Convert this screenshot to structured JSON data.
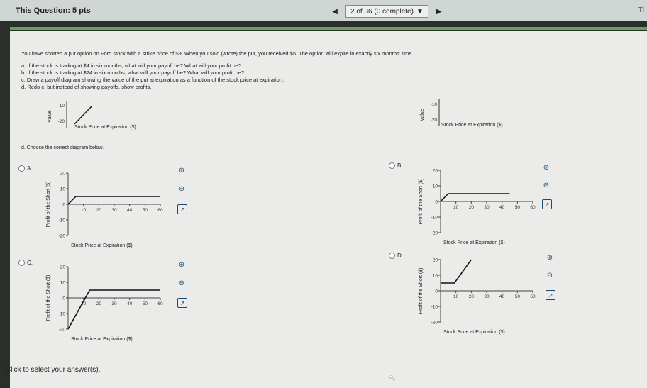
{
  "header": {
    "question_label": "This Question: 5 pts",
    "counter": "2 of 36 (0 complete)",
    "right_text": "Tl"
  },
  "question": {
    "prompt": "You have shorted a put option on Ford stock with a strike price of $9. When you sold (wrote) the put, you received $5. The option will expire in exactly six months' time.",
    "items": [
      "a. If the stock is trading at $4 in six months, what will your payoff be? What will your profit be?",
      "b. If the stock is trading at $24 in six months, what will your payoff be? What will your profit be?",
      "c. Draw a payoff diagram showing the value of the put at expiration as a function of the stock price at expiration.",
      "d. Redo c, but instead of showing payoffs, show profits."
    ],
    "sub_prompt": "d. Choose the correct diagram below."
  },
  "top_charts": {
    "left": {
      "ylabel": "Value",
      "xlabel": "Stock Price at Expiration ($)",
      "ticks": [
        "-10",
        "-20"
      ]
    },
    "right": {
      "ylabel": "Value",
      "xlabel": "Stock Price at Expiration ($)",
      "ticks": [
        "-10",
        "-20"
      ]
    }
  },
  "options": [
    {
      "letter": "A.",
      "ylabel": "Profit of the Short ($)",
      "xlabel": "Stock Price at Expiration ($)"
    },
    {
      "letter": "B.",
      "ylabel": "Profit of the Short ($)",
      "xlabel": "Stock Price at Expiration ($)"
    },
    {
      "letter": "C.",
      "ylabel": "Profit of the Short ($)",
      "xlabel": "Stock Price at Expiration ($)"
    },
    {
      "letter": "D.",
      "ylabel": "Profit of the Short ($)",
      "xlabel": "Stock Price at Expiration ($)"
    }
  ],
  "chart_data": [
    {
      "type": "line",
      "x": [
        0,
        5,
        60
      ],
      "y": [
        0,
        5,
        5
      ],
      "ylim": [
        -20,
        20
      ],
      "xlim": [
        0,
        60
      ],
      "xticks": [
        10,
        20,
        30,
        40,
        50,
        60
      ],
      "yticks": [
        20,
        10,
        0,
        -10,
        -20
      ]
    },
    {
      "type": "line",
      "x": [
        0,
        5,
        45
      ],
      "y": [
        0,
        5,
        5
      ],
      "ylim": [
        -20,
        20
      ],
      "xlim": [
        0,
        60
      ],
      "xticks": [
        10,
        20,
        30,
        40,
        50,
        60
      ],
      "yticks": [
        20,
        10,
        0,
        -10,
        -20
      ]
    },
    {
      "type": "line",
      "x": [
        0,
        14,
        60
      ],
      "y": [
        -20,
        5,
        5
      ],
      "ylim": [
        -20,
        20
      ],
      "xlim": [
        0,
        60
      ],
      "xticks": [
        10,
        20,
        30,
        40,
        50,
        60
      ],
      "yticks": [
        20,
        10,
        0,
        -10,
        -20
      ]
    },
    {
      "type": "line",
      "x": [
        0,
        9,
        20
      ],
      "y": [
        5,
        5,
        20
      ],
      "ylim": [
        -20,
        20
      ],
      "xlim": [
        0,
        60
      ],
      "xticks": [
        10,
        20,
        30,
        40,
        50,
        60
      ],
      "yticks": [
        20,
        10,
        0,
        -10,
        -20
      ]
    }
  ],
  "footer": {
    "text": "Click to select your answer(s)."
  },
  "colors": {
    "accent_bar": "#6aa05a",
    "tool_icon": "#1c4a6e"
  }
}
